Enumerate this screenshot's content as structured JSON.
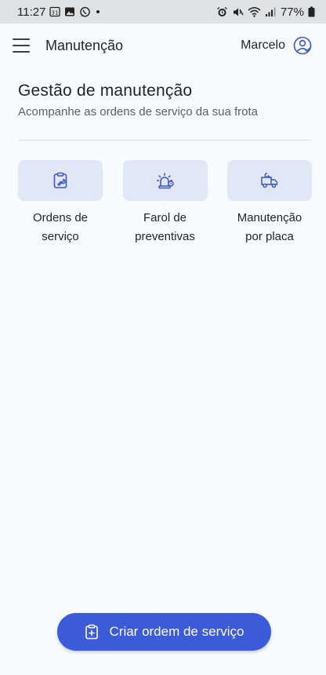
{
  "status_bar": {
    "time": "11:27",
    "battery": "77%",
    "icons_left": [
      "calendar-31-icon",
      "image-icon",
      "whatsapp-icon",
      "dot-icon"
    ],
    "icons_right": [
      "alarm-icon",
      "mute-icon",
      "wifi-icon",
      "signal-icon",
      "battery-icon"
    ]
  },
  "app_bar": {
    "title": "Manutenção",
    "user_name": "Marcelo",
    "menu_icon": "hamburger-menu-icon",
    "user_icon": "user-circle-icon"
  },
  "header": {
    "title": "Gestão de manutenção",
    "subtitle": "Acompanhe as ordens de serviço da sua frota"
  },
  "cards": [
    {
      "label": "Ordens de\nserviço",
      "icon": "clipboard-wrench-icon"
    },
    {
      "label": "Farol de\npreventivas",
      "icon": "siren-light-icon"
    },
    {
      "label": "Manutenção\npor placa",
      "icon": "truck-wrench-icon"
    }
  ],
  "fab": {
    "label": "Criar ordem de serviço",
    "icon": "clipboard-plus-icon"
  },
  "colors": {
    "accent": "#3b5bd9",
    "card_bg": "#e2e7f8",
    "icon": "#3b57c9",
    "background": "#f7fbfd",
    "status_bar": "#dfe2e5"
  }
}
